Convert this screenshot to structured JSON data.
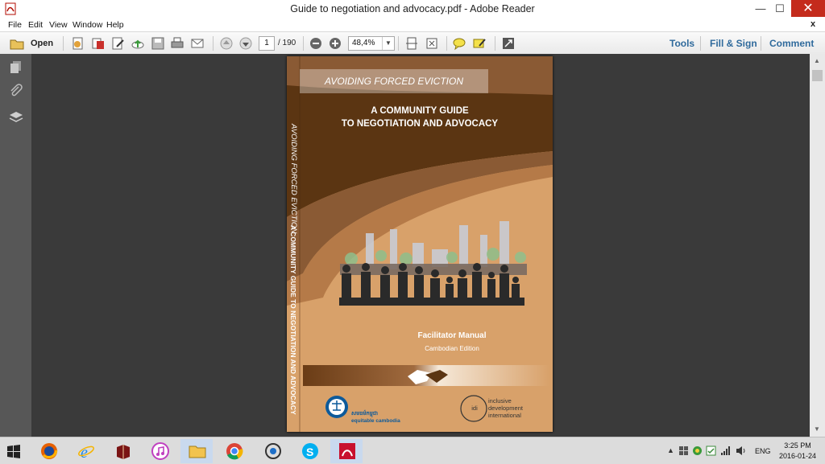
{
  "window": {
    "title": "Guide to negotiation and advocacy.pdf - Adobe Reader",
    "minimize": "—",
    "maximize": "☐",
    "close": "✕"
  },
  "menu": {
    "items": [
      "File",
      "Edit",
      "View",
      "Window",
      "Help"
    ],
    "close": "x"
  },
  "toolbar": {
    "open_label": "Open",
    "page_number": "1",
    "page_total": "/ 190",
    "zoom": "48,4%",
    "tools": "Tools",
    "fill_sign": "Fill & Sign",
    "comment": "Comment"
  },
  "document": {
    "band_text": "AVOIDING FORCED EVICTION",
    "title_line1": "A COMMUNITY GUIDE",
    "title_line2": "TO NEGOTIATION AND ADVOCACY",
    "spine_text1": "AVOIDING FORCED EVICTION",
    "spine_text2": "A COMMUNITY GUIDE TO NEGOTIATION AND ADVOCACY",
    "facilitator": "Facilitator Manual",
    "edition": "Cambodian Edition",
    "logo1_khmer": "សមធម៌កម្ពុជា",
    "logo1_text": "equitable cambodia",
    "logo2_abbr": "idi",
    "logo2_line1": "inclusive",
    "logo2_line2": "development",
    "logo2_line3": "international"
  },
  "taskbar": {
    "language": "ENG",
    "time": "3:25 PM",
    "date": "2016-01-24"
  },
  "colors": {
    "accent_text": "#2f6a9c",
    "cover_dark": "#5b3512",
    "cover_light": "#d8a16a",
    "close_red": "#c42b1c"
  }
}
